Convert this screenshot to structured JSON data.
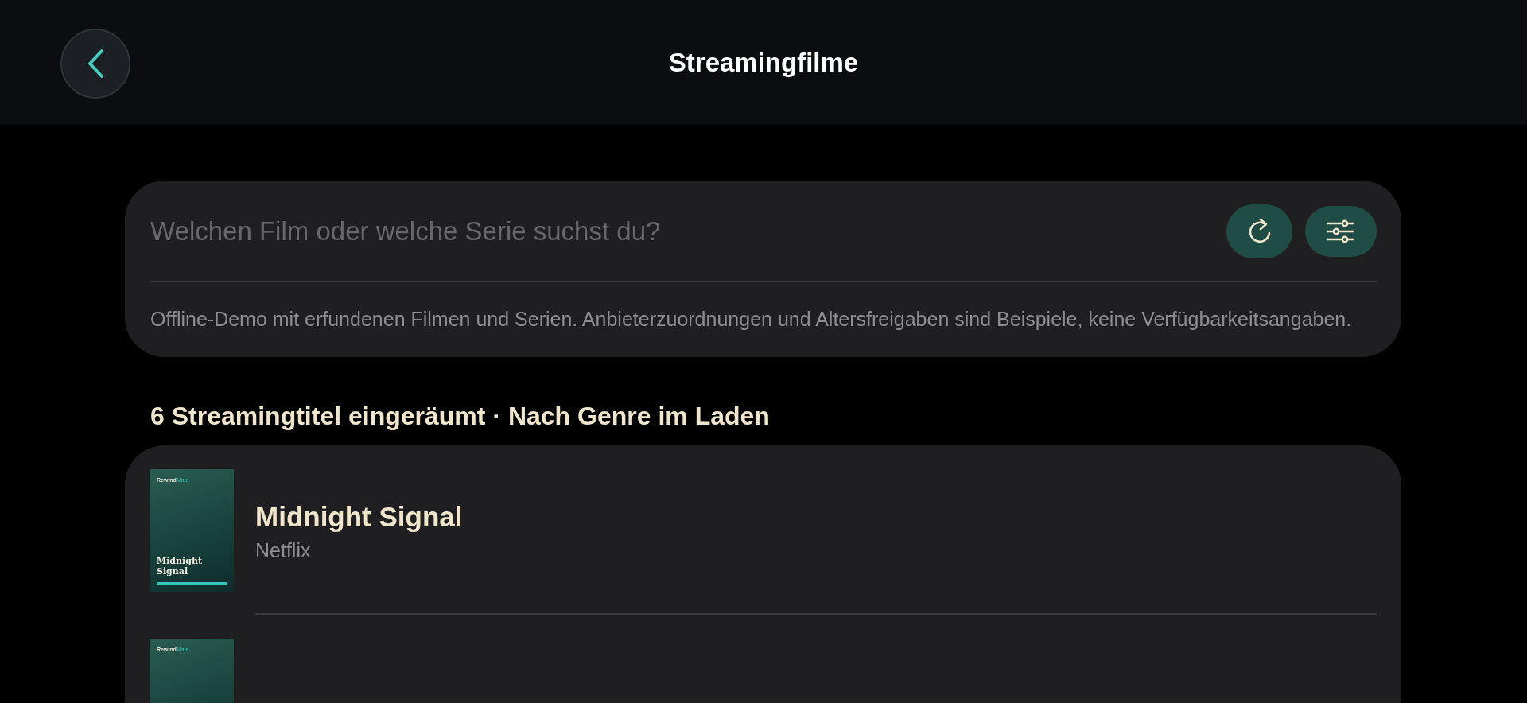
{
  "header": {
    "title": "Streamingfilme"
  },
  "search": {
    "placeholder": "Welchen Film oder welche Serie suchst du?",
    "note": "Offline-Demo mit erfundenen Filmen und Serien. Anbieterzuordnungen und Altersfreigaben sind Beispiele, keine Verfügbarkeitsangaben."
  },
  "section_heading": "6 Streamingtitel eingeräumt · Nach Genre im Laden",
  "titles": [
    {
      "poster": {
        "brand": "Rewind",
        "brand_accent": "Mate",
        "title": "Midnight Signal"
      },
      "title": "Midnight Signal",
      "provider": "Netflix"
    },
    {
      "poster": {
        "brand": "Rewind",
        "brand_accent": "Mate"
      }
    }
  ]
}
